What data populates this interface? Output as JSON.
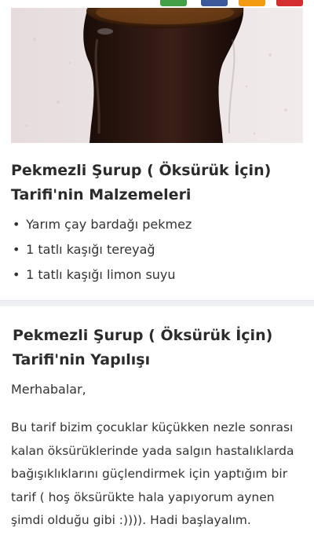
{
  "photo": {
    "subject": "pekmez syrup in tea glass"
  },
  "ingredients": {
    "title": "Pekmezli Şurup ( Öksürük İçin) Tarifi'nin Malzemeleri",
    "bullet": "•",
    "items": [
      "Yarım çay  bardağı pekmez",
      "1 tatlı  kaşığı tereyağ",
      "1  tatlı kaşığı  limon suyu"
    ]
  },
  "preparation": {
    "title": "Pekmezli Şurup ( Öksürük İçin) Tarifi'nin Yapılışı",
    "greeting": "Merhabalar,",
    "paragraph_lines": [
      "Bu tarif bizim çocuklar küçükken nezle sonrası",
      "kalan öksürüklerinde yada salgın hastalıklarda",
      "bağışıklıklarını güçlendirmek için yaptığım  bir",
      "tarif ( hoş öksürükte hala yapıyorum aynen",
      "şimdi olduğu gibi :)))). Hadi başlayalım."
    ]
  },
  "colors": {
    "share_green": "#43a047",
    "share_blue": "#3b5998",
    "share_orange": "#f39c12",
    "share_red": "#d32f2f"
  }
}
